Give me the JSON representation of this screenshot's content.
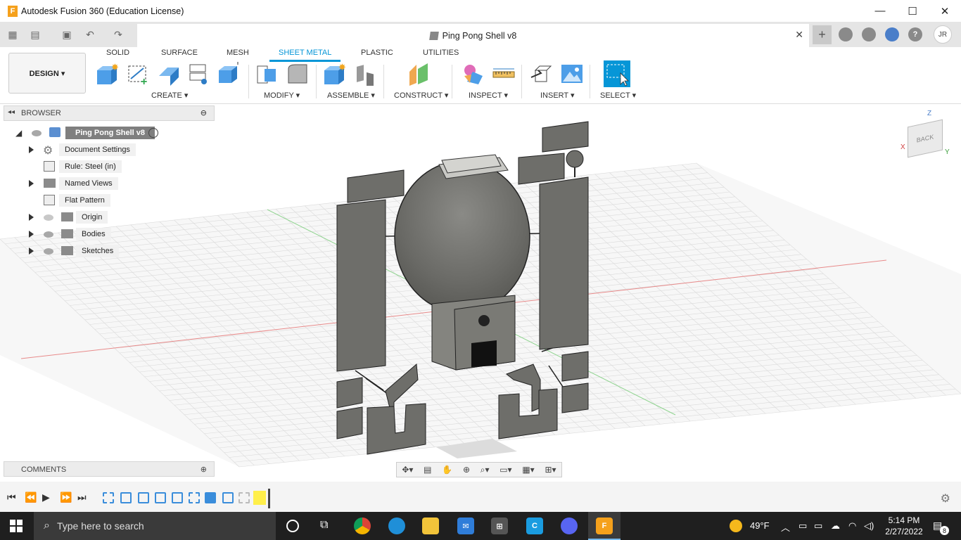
{
  "window": {
    "title": "Autodesk Fusion 360 (Education License)",
    "logo": "F",
    "minimize": "—",
    "maximize": "☐",
    "close": "✕"
  },
  "document": {
    "tab_title": "Ping Pong Shell v8",
    "close_glyph": "✕",
    "add_glyph": "+",
    "user_initials": "JR"
  },
  "ribbon": {
    "workspace": "DESIGN ▾",
    "tabs": [
      "SOLID",
      "SURFACE",
      "MESH",
      "SHEET METAL",
      "PLASTIC",
      "UTILITIES"
    ],
    "active_tab": "SHEET METAL",
    "groups": [
      "CREATE ▾",
      "MODIFY ▾",
      "ASSEMBLE ▾",
      "CONSTRUCT ▾",
      "INSPECT ▾",
      "INSERT ▾",
      "SELECT ▾"
    ]
  },
  "browser": {
    "header": "BROWSER",
    "items": [
      {
        "label": "Ping Pong Shell v8"
      },
      {
        "label": "Document Settings"
      },
      {
        "label": "Rule: Steel (in)"
      },
      {
        "label": "Named Views"
      },
      {
        "label": "Flat Pattern"
      },
      {
        "label": "Origin"
      },
      {
        "label": "Bodies"
      },
      {
        "label": "Sketches"
      }
    ]
  },
  "comments": {
    "header": "COMMENTS"
  },
  "viewcube": {
    "face": "BACK",
    "axis_z": "Z",
    "axis_x": "X",
    "axis_y": "Y"
  },
  "taskbar": {
    "search_placeholder": "Type here to search",
    "weather": "49°F",
    "time": "5:14 PM",
    "date": "2/27/2022",
    "notifications": "8"
  },
  "colors": {
    "accent": "#0696d7",
    "part": "#6e6e6a",
    "grid": "#d8d8d8",
    "axis_red": "#e88080",
    "axis_green": "#8bd08b"
  }
}
